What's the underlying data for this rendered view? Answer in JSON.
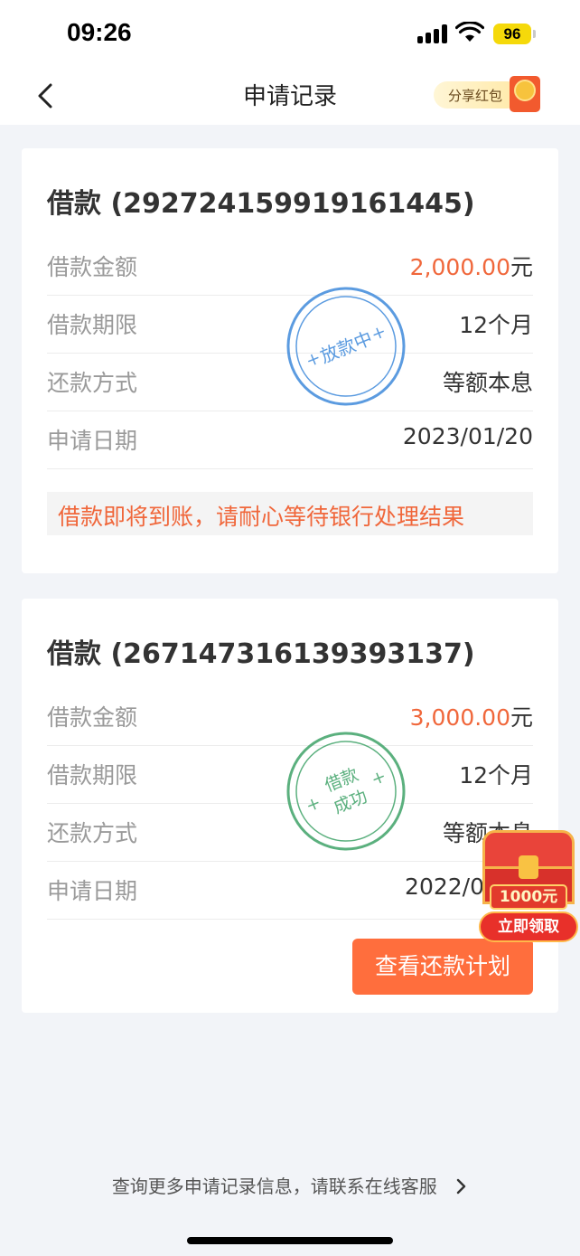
{
  "status_bar": {
    "time": "09:26",
    "battery": "96"
  },
  "nav": {
    "title": "申请记录",
    "share_label": "分享红包"
  },
  "loans": [
    {
      "title": "借款 (292724159919161445)",
      "rows": [
        {
          "label": "借款金额",
          "value": "2,000.00",
          "unit": "元"
        },
        {
          "label": "借款期限",
          "value": "12个月"
        },
        {
          "label": "还款方式",
          "value": "等额本息"
        },
        {
          "label": "申请日期",
          "value": "2023/01/20"
        }
      ],
      "stamp": {
        "text": "放款中",
        "color": "#5b9be0"
      },
      "notice": "借款即将到账，请耐心等待银行处理结果"
    },
    {
      "title": "借款 (267147316139393137)",
      "rows": [
        {
          "label": "借款金额",
          "value": "3,000.00",
          "unit": "元"
        },
        {
          "label": "借款期限",
          "value": "12个月"
        },
        {
          "label": "还款方式",
          "value": "等额本息"
        },
        {
          "label": "申请日期",
          "value": "2022/0"
        }
      ],
      "stamp": {
        "line1": "借款",
        "line2": "成功",
        "color": "#5bb07e"
      },
      "action_label": "查看还款计划"
    }
  ],
  "promo": {
    "amount": "1000元",
    "claim_label": "立即领取"
  },
  "footer": {
    "link_text": "查询更多申请记录信息，请联系在线客服"
  },
  "colors": {
    "accent": "#f0673b",
    "button": "#ff6e3d",
    "stamp_blue": "#5b9be0",
    "stamp_green": "#5bb07e"
  }
}
